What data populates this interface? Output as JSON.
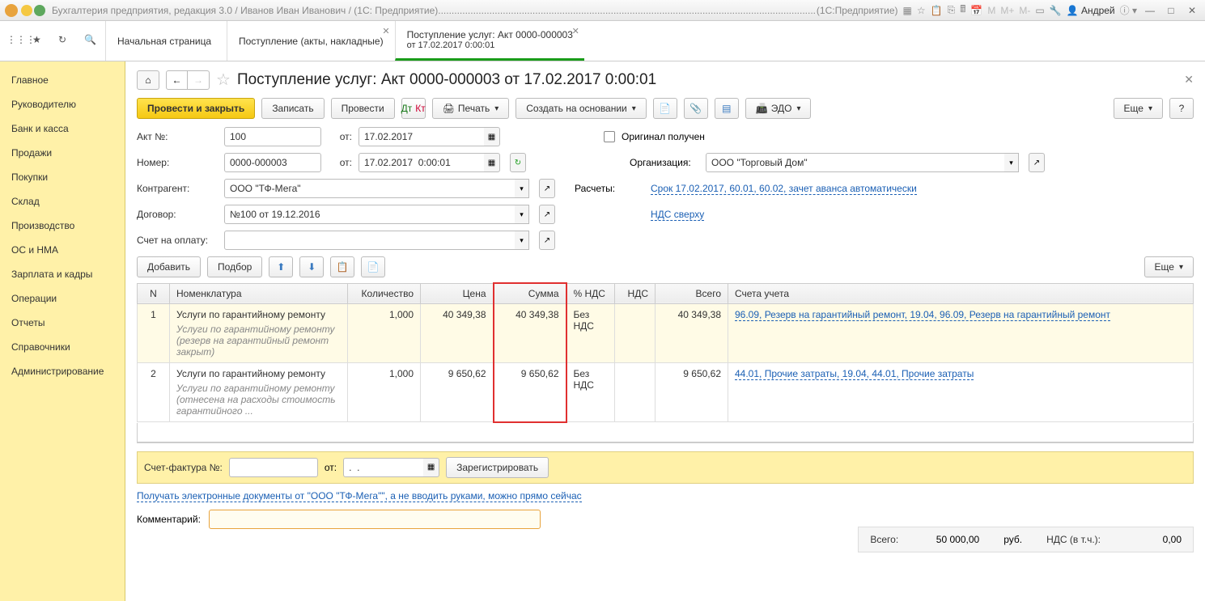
{
  "titlebar": {
    "caption": "Бухгалтерия предприятия, редакция 3.0 / Иванов Иван Иванович / (1С: Предприятие)..............................................................................................................................................................................",
    "mode": "(1С:Предприятие)",
    "user": "Андрей",
    "m": "M",
    "mplus": "M+",
    "mminus": "M-"
  },
  "tabs": {
    "t0": "Начальная страница",
    "t1": "Поступление (акты, накладные)",
    "t2a": "Поступление услуг: Акт 0000-000003",
    "t2b": "от 17.02.2017 0:00:01"
  },
  "sidebar": {
    "i0": "Главное",
    "i1": "Руководителю",
    "i2": "Банк и касса",
    "i3": "Продажи",
    "i4": "Покупки",
    "i5": "Склад",
    "i6": "Производство",
    "i7": "ОС и НМА",
    "i8": "Зарплата и кадры",
    "i9": "Операции",
    "i10": "Отчеты",
    "i11": "Справочники",
    "i12": "Администрирование"
  },
  "doc": {
    "title": "Поступление услуг: Акт 0000-000003 от 17.02.2017 0:00:01"
  },
  "toolbar": {
    "post_close": "Провести и закрыть",
    "save": "Записать",
    "post": "Провести",
    "print": "Печать",
    "create_based": "Создать на основании",
    "edo": "ЭДО",
    "more": "Еще",
    "help": "?"
  },
  "form": {
    "akt_no_lbl": "Акт №:",
    "akt_no": "100",
    "ot_lbl": "от:",
    "akt_date": "17.02.2017",
    "number_lbl": "Номер:",
    "number": "0000-000003",
    "number_date": "17.02.2017  0:00:01",
    "contragent_lbl": "Контрагент:",
    "contragent": "ООО \"ТФ-Мега\"",
    "dogovor_lbl": "Договор:",
    "dogovor": "№100 от 19.12.2016",
    "schet_lbl": "Счет на оплату:",
    "original_lbl": "Оригинал получен",
    "org_lbl": "Организация:",
    "org": "ООО \"Торговый Дом\"",
    "raschety_lbl": "Расчеты:",
    "raschety_link": "Срок 17.02.2017, 60.01, 60.02, зачет аванса автоматически",
    "nds_link": "НДС сверху"
  },
  "tbltb": {
    "add": "Добавить",
    "select": "Подбор",
    "more": "Еще"
  },
  "th": {
    "n": "N",
    "nomen": "Номенклатура",
    "qty": "Количество",
    "price": "Цена",
    "sum": "Сумма",
    "pctnds": "% НДС",
    "nds": "НДС",
    "total": "Всего",
    "accounts": "Счета учета"
  },
  "rows": {
    "r1": {
      "n": "1",
      "name": "Услуги по гарантийному ремонту",
      "sub": "Услуги по гарантийному ремонту (резерв на гарантийный ремонт закрыт)",
      "qty": "1,000",
      "price": "40 349,38",
      "sum": "40 349,38",
      "pctnds": "Без НДС",
      "total": "40 349,38",
      "accounts": "96.09, Резерв на гарантийный ремонт, 19.04, 96.09, Резерв на гарантийный ремонт"
    },
    "r2": {
      "n": "2",
      "name": "Услуги по гарантийному ремонту",
      "sub": "Услуги по гарантийному ремонту (отнесена на расходы стоимость гарантийного ...",
      "qty": "1,000",
      "price": "9 650,62",
      "sum": "9 650,62",
      "pctnds": "Без НДС",
      "total": "9 650,62",
      "accounts": "44.01, Прочие затраты, 19.04, 44.01, Прочие затраты"
    }
  },
  "footer": {
    "sf_lbl": "Счет-фактура №:",
    "sf_ot": "от:",
    "sf_date": ".  .",
    "sf_register": "Зарегистрировать",
    "totals_lbl": "Всего:",
    "totals_val": "50 000,00",
    "rub": "руб.",
    "nds_lbl": "НДС (в т.ч.):",
    "nds_val": "0,00",
    "edoc_link": "Получать электронные документы от \"ООО \"ТФ-Мега\"\", а не вводить руками, можно прямо сейчас",
    "comment_lbl": "Комментарий:"
  }
}
